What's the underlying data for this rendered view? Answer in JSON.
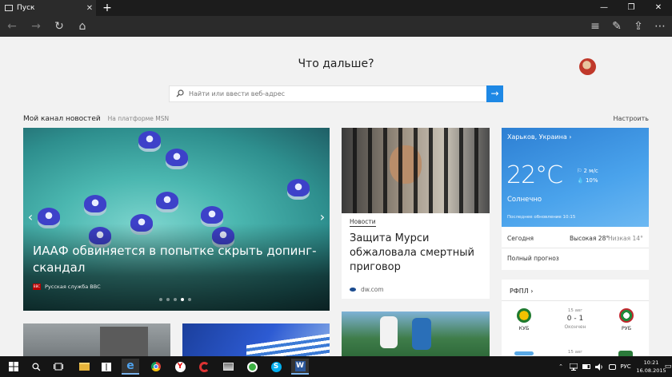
{
  "browser": {
    "tab_title": "Пуск",
    "tab_close": "✕",
    "new_tab": "+",
    "window_controls": {
      "minimize": "—",
      "maximize": "❐",
      "close": "✕"
    },
    "nav": {
      "back": "←",
      "forward": "→",
      "refresh": "↻",
      "home": "⌂",
      "hub": "≡",
      "note": "✎",
      "share": "⇪",
      "more": "⋯"
    }
  },
  "start": {
    "title": "Что дальше?",
    "search_placeholder": "Найти или ввести веб-адрес",
    "go": "→"
  },
  "feed": {
    "heading": "Мой канал новостей",
    "platform": "На платформе MSN",
    "customize": "Настроить"
  },
  "hero": {
    "title": "ИААФ обвиняется в попытке скрыть допинг-скандал",
    "source_logo": "BBC",
    "source": "Русская служба BBC",
    "prev": "‹",
    "next": "›",
    "slides": 5,
    "active_slide": 4
  },
  "news_card": {
    "category": "Новости",
    "title": "Защита Мурси обжаловала смертный приговор",
    "source": "dw.com"
  },
  "weather": {
    "city": "Харьков, Украина ›",
    "temp": "22°C",
    "wind": "⚐ 2 м/с",
    "humidity": "💧 10%",
    "condition": "Солнечно",
    "updated": "Последнее обновление 10:15",
    "today_label": "Сегодня",
    "high": "Высокая 28°",
    "low": "Низкая 14°",
    "forecast": "Полный прогноз",
    "colors": {
      "sky_top": "#2d7fd3",
      "sky_bottom": "#6cb8f2"
    }
  },
  "rfpl": {
    "title": "РФПЛ ›",
    "home_team": "КУБ",
    "away_team": "РУБ",
    "date": "15 авг",
    "score": "0 - 1",
    "status": "Окончен",
    "date2": "15 авг"
  },
  "taskbar": {
    "clock_time": "10:21",
    "clock_date": "16.08.2015",
    "lang": "РУС",
    "tray_up": "⌃",
    "tray_notify": "▭"
  }
}
